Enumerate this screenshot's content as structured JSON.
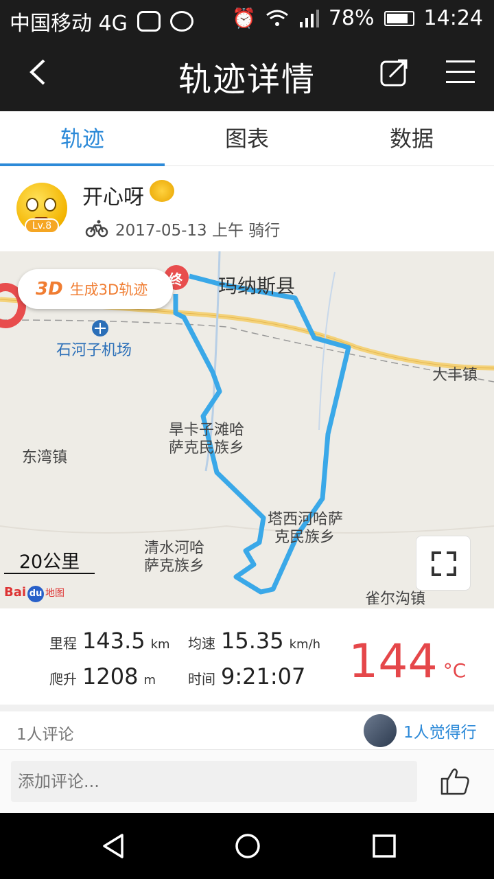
{
  "status_bar": {
    "carrier": "中国移动 4G",
    "battery_percent": "78%",
    "time": "14:24"
  },
  "header": {
    "title": "轨迹详情",
    "back_icon": "chevron-left-icon",
    "share_icon": "share-icon",
    "menu_icon": "hamburger-menu-icon"
  },
  "tabs": [
    {
      "label": "轨迹",
      "active": true
    },
    {
      "label": "图表",
      "active": false
    },
    {
      "label": "数据",
      "active": false
    }
  ],
  "profile": {
    "username": "开心呀",
    "level": "Lv.8",
    "datetime": "2017-05-13 上午 骑行"
  },
  "map": {
    "generate_3d_badge": "3D",
    "generate_3d_label": "生成3D轨迹",
    "end_marker": "终",
    "places": {
      "manas": "玛纳斯县",
      "airport": "石河子机场",
      "dafeng": "大丰镇",
      "hanka": "旱卡子滩哈",
      "hanka2": "萨克民族乡",
      "dongwan": "东湾镇",
      "taxihe": "塔西河哈萨",
      "taxihe2": "克民族乡",
      "qingshuihe": "清水河哈",
      "qingshuihe2": "萨克族乡",
      "queergou": "雀尔沟镇"
    },
    "scale": "20公里",
    "attribution_bai": "Bai",
    "attribution_du": "du",
    "attribution_map": "地图",
    "route_color": "#3aa8e8"
  },
  "stats": {
    "distance_label": "里程",
    "distance_value": "143.5",
    "distance_unit": "km",
    "avg_speed_label": "均速",
    "avg_speed_value": "15.35",
    "avg_speed_unit": "km/h",
    "climb_label": "爬升",
    "climb_value": "1208",
    "climb_unit": "m",
    "time_label": "时间",
    "time_value": "9:21:07",
    "temperature_value": "144",
    "temperature_unit": "°C"
  },
  "comments": {
    "count_text": "1人评论",
    "likes_text": "1人觉得行"
  },
  "comment_input": {
    "placeholder": "添加评论..."
  },
  "colors": {
    "accent": "#2d8ad8",
    "temperature": "#e5474a",
    "header_bg": "#1c1c1c"
  }
}
